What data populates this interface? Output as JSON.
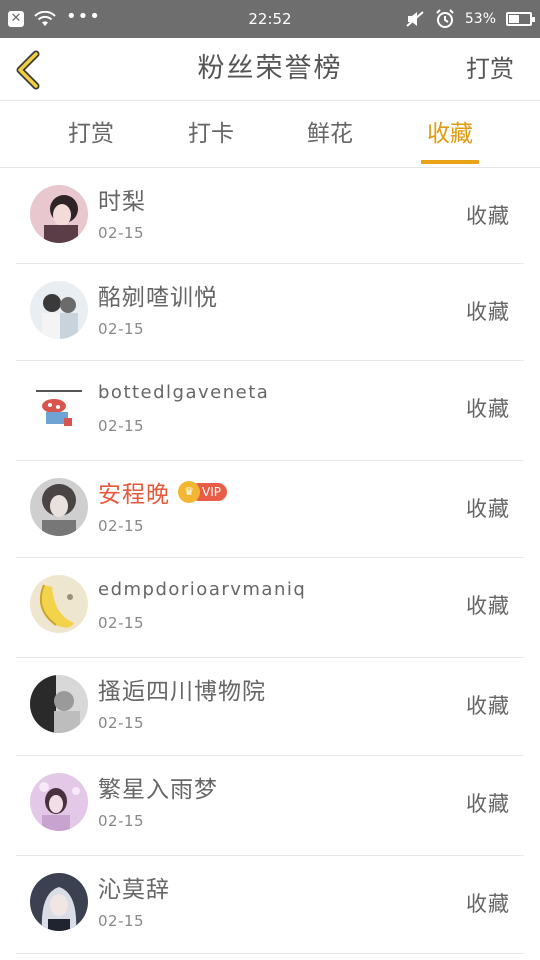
{
  "status": {
    "time": "22:52",
    "battery": "53%"
  },
  "header": {
    "title": "粉丝荣誉榜",
    "action": "打赏"
  },
  "tabs": [
    {
      "label": "打赏"
    },
    {
      "label": "打卡"
    },
    {
      "label": "鲜花"
    },
    {
      "label": "收藏"
    }
  ],
  "active_tab": "收藏",
  "vip_label": "VIP",
  "rows": [
    {
      "name": "时梨",
      "date": "02-15",
      "action": "收藏"
    },
    {
      "name": "酩剜喳训悦",
      "date": "02-15",
      "action": "收藏"
    },
    {
      "name": "bottedlgaveneta",
      "date": "02-15",
      "action": "收藏"
    },
    {
      "name": "安程晚",
      "date": "02-15",
      "action": "收藏"
    },
    {
      "name": "edmpdorioarvmaniq",
      "date": "02-15",
      "action": "收藏"
    },
    {
      "name": "搔逅四川博物院",
      "date": "02-15",
      "action": "收藏"
    },
    {
      "name": "繁星入雨梦",
      "date": "02-15",
      "action": "收藏"
    },
    {
      "name": "沁莫辞",
      "date": "02-15",
      "action": "收藏"
    }
  ],
  "colors": {
    "accent": "#e8a317",
    "vip_name": "#e8593a",
    "status_bar": "#6e6e6e"
  }
}
